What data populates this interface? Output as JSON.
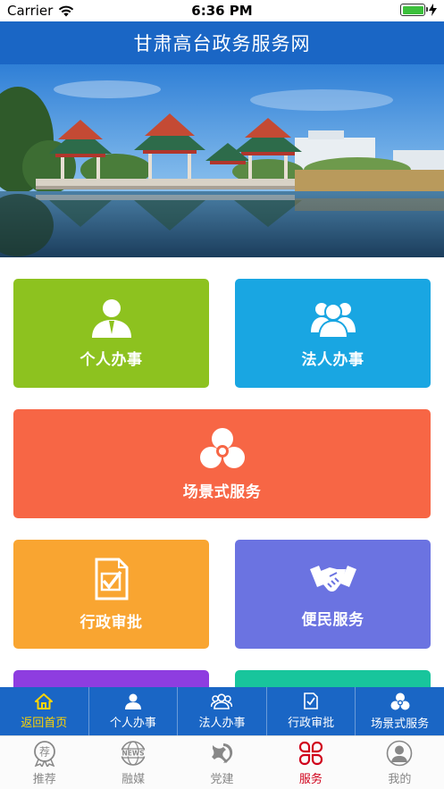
{
  "status_bar": {
    "carrier": "Carrier",
    "time": "6:36 PM"
  },
  "header": {
    "title": "甘肃高台政务服务网"
  },
  "banner": {
    "slides": 3,
    "active_slide": 2
  },
  "tiles": {
    "personal": {
      "label": "个人办事",
      "color": "#8dc21f",
      "icon": "person-icon"
    },
    "corporate": {
      "label": "法人办事",
      "color": "#19a6e2",
      "icon": "group-icon"
    },
    "scenario": {
      "label": "场景式服务",
      "color": "#f76645",
      "icon": "tri-circle-icon"
    },
    "approval": {
      "label": "行政审批",
      "color": "#f9a531",
      "icon": "checklist-icon"
    },
    "convenience": {
      "label": "便民服务",
      "color": "#6b73e1",
      "icon": "handshake-icon"
    },
    "more_left_color": "#8e3de0",
    "more_right_color": "#18c59c"
  },
  "quick_nav": {
    "items": [
      {
        "label": "返回首页",
        "icon": "home-icon"
      },
      {
        "label": "个人办事",
        "icon": "person-icon"
      },
      {
        "label": "法人办事",
        "icon": "group-icon"
      },
      {
        "label": "行政审批",
        "icon": "checklist-icon"
      },
      {
        "label": "场景式服务",
        "icon": "tri-circle-icon"
      }
    ],
    "active_index": 0
  },
  "tab_bar": {
    "items": [
      {
        "label": "推荐",
        "icon": "recommend-icon",
        "glyph": "荐"
      },
      {
        "label": "融媒",
        "icon": "globe-news-icon",
        "glyph": "NEWS"
      },
      {
        "label": "党建",
        "icon": "party-emblem-icon"
      },
      {
        "label": "服务",
        "icon": "grid-service-icon"
      },
      {
        "label": "我的",
        "icon": "user-profile-icon"
      }
    ],
    "active_index": 3
  },
  "colors": {
    "primary": "#1a66c5",
    "active_tab": "#d0021b",
    "active_quick_nav": "#ffd400"
  }
}
